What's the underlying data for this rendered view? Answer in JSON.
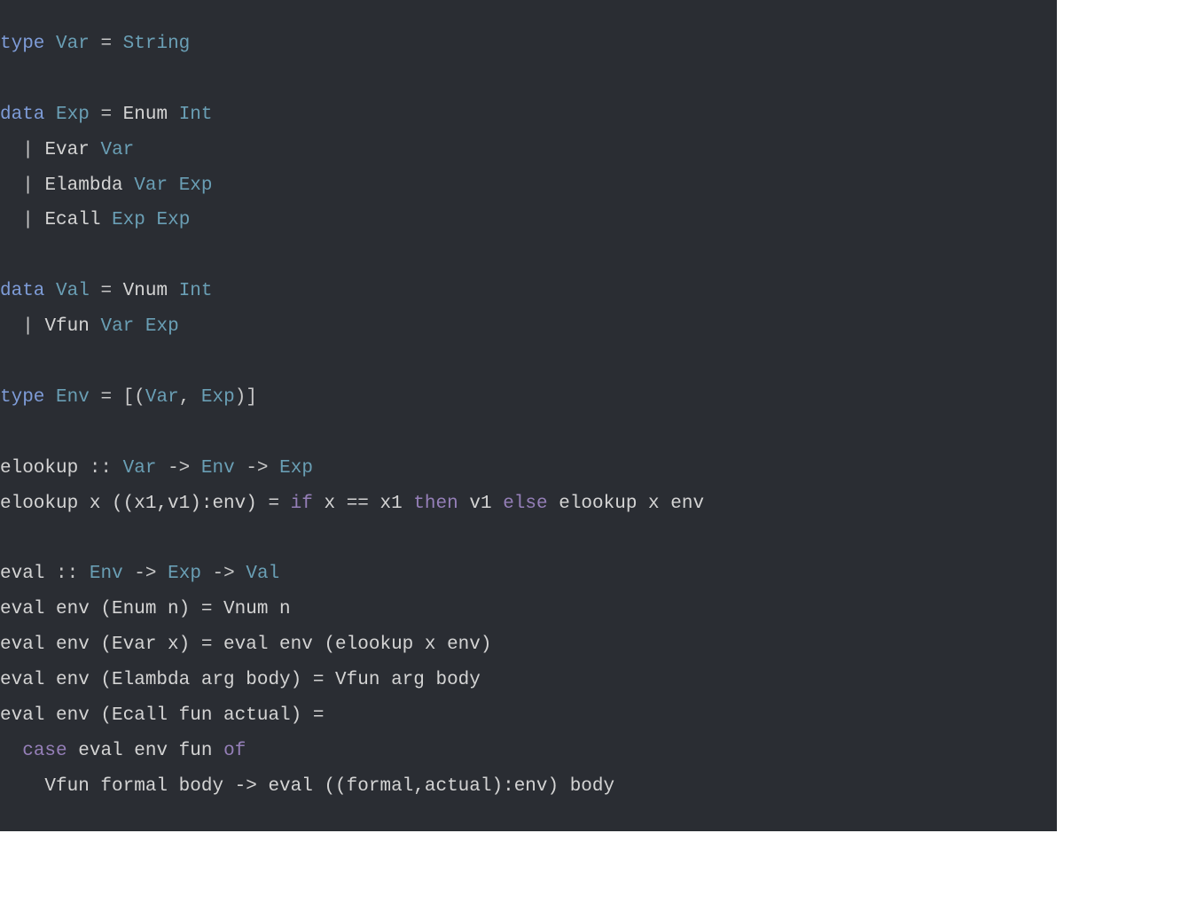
{
  "code": {
    "line1": {
      "kw_type": "type",
      "var": "Var",
      "eq": "=",
      "string": "String"
    },
    "line3": {
      "kw_data": "data",
      "exp": "Exp",
      "eq": "=",
      "enum": "Enum",
      "int": "Int"
    },
    "line4": {
      "pipe": "|",
      "evar": "Evar",
      "var": "Var"
    },
    "line5": {
      "pipe": "|",
      "elambda": "Elambda",
      "var": "Var",
      "exp": "Exp"
    },
    "line6": {
      "pipe": "|",
      "ecall": "Ecall",
      "exp1": "Exp",
      "exp2": "Exp"
    },
    "line8": {
      "kw_data": "data",
      "val": "Val",
      "eq": "=",
      "vnum": "Vnum",
      "int": "Int"
    },
    "line9": {
      "pipe": "|",
      "vfun": "Vfun",
      "var": "Var",
      "exp": "Exp"
    },
    "line11": {
      "kw_type": "type",
      "env": "Env",
      "eq": "=",
      "lbrack": "[(",
      "var": "Var",
      "comma": ",",
      "exp": "Exp",
      "rbrack": ")]"
    },
    "line13": {
      "elookup": "elookup",
      "dcolon": "::",
      "var": "Var",
      "arrow1": "->",
      "env": "Env",
      "arrow2": "->",
      "exp": "Exp"
    },
    "line14": {
      "elookup": "elookup x ((x1,v1):env) =",
      "kw_if": "if",
      "cond": "x == x1",
      "kw_then": "then",
      "then_val": "v1",
      "kw_else": "else",
      "else_val": "elookup x env"
    },
    "line16": {
      "eval": "eval",
      "dcolon": "::",
      "env": "Env",
      "arrow1": "->",
      "exp": "Exp",
      "arrow2": "->",
      "val": "Val"
    },
    "line17": "eval env (Enum n) = Vnum n",
    "line18": "eval env (Evar x) = eval env (elookup x env)",
    "line19": "eval env (Elambda arg body) = Vfun arg body",
    "line20": "eval env (Ecall fun actual) =",
    "line21": {
      "kw_case": "case",
      "expr": "eval env fun",
      "kw_of": "of"
    },
    "line22": "    Vfun formal body -> eval ((formal,actual):env) body"
  }
}
